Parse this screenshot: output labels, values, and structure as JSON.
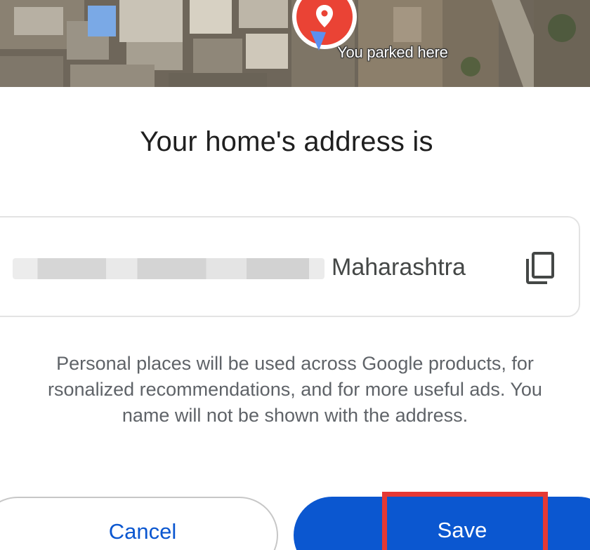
{
  "map": {
    "parked_label": "You parked here",
    "pin_icon": "location-pin-icon",
    "pin_color": "#ea4335"
  },
  "dialog": {
    "title": "Your home's address is",
    "address": {
      "visible_text": "Maharashtra",
      "copy_icon": "copy-icon"
    },
    "disclaimer_lines": [
      "Personal places will be used across Google products, for",
      "rsonalized recommendations, and for more useful ads. You",
      "name will not be shown with the address."
    ],
    "buttons": {
      "cancel_label": "Cancel",
      "save_label": "Save"
    }
  },
  "colors": {
    "primary": "#0b57d0",
    "highlight": "#e53935",
    "title_text": "#1f1f1f",
    "secondary_text": "#5f6368"
  }
}
